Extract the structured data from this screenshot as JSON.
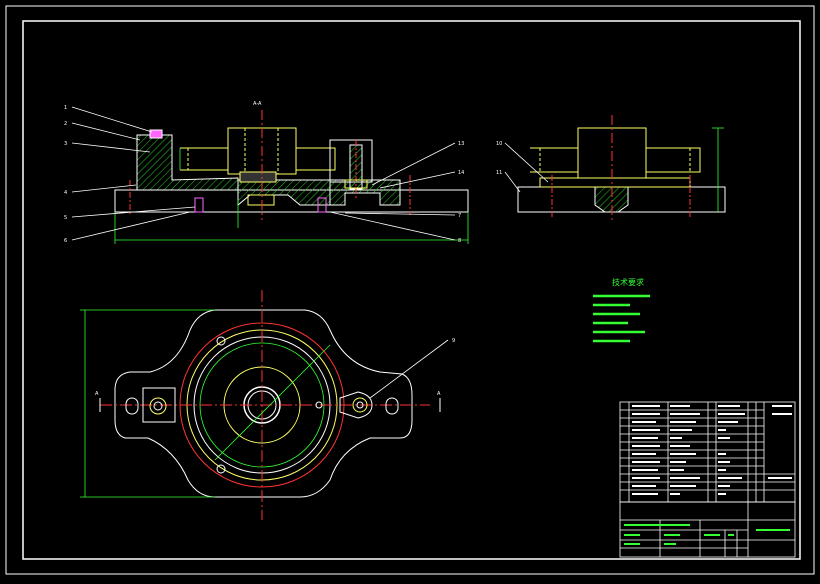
{
  "tech_requirements": {
    "title": "技术要求"
  },
  "view_markers": {
    "front_section": "A-A",
    "plan_left": "A",
    "plan_right": "A"
  },
  "part_balloons": {
    "left": [
      "1",
      "2",
      "3",
      "4",
      "5",
      "6"
    ],
    "right": [
      "13",
      "14",
      "7",
      "8"
    ],
    "side_view": [
      "10",
      "11"
    ],
    "plan_view": [
      "9"
    ]
  },
  "colors": {
    "background": "#000000",
    "outline": "#ffffff",
    "part": "#ffff66",
    "hatch": "#22dd22",
    "centerline": "#ff3333",
    "dimension": "#33ff33",
    "fastener": "#ff66ff",
    "section": "#00ffff"
  },
  "icons": [
    "hex-nut-icon",
    "bolt-icon",
    "swing-bolt-icon"
  ]
}
